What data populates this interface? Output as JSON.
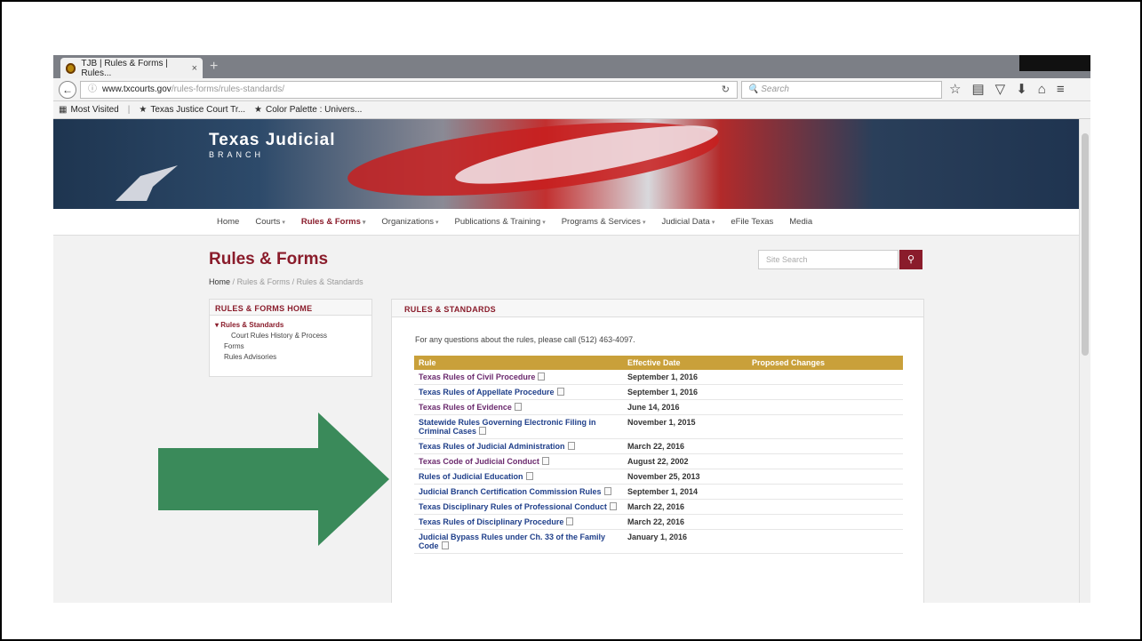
{
  "browser": {
    "tab_title": "TJB | Rules & Forms | Rules...",
    "tab_close": "×",
    "new_tab": "+",
    "url_host": "www.txcourts.gov",
    "url_path": "/rules-forms/rules-standards/",
    "search_placeholder": "Search",
    "bookmarks": [
      "Most Visited",
      "Texas Justice Court Tr...",
      "Color Palette : Univers..."
    ]
  },
  "site": {
    "brand_title": "Texas Judicial",
    "brand_sub": "BRANCH",
    "nav": [
      {
        "label": "Home",
        "caret": ""
      },
      {
        "label": "Courts",
        "caret": "▾"
      },
      {
        "label": "Rules & Forms",
        "caret": "▾"
      },
      {
        "label": "Organizations",
        "caret": "▾"
      },
      {
        "label": "Publications & Training",
        "caret": "▾"
      },
      {
        "label": "Programs & Services",
        "caret": "▾"
      },
      {
        "label": "Judicial Data",
        "caret": "▾"
      },
      {
        "label": "eFile Texas",
        "caret": ""
      },
      {
        "label": "Media",
        "caret": ""
      }
    ],
    "page_title": "Rules & Forms",
    "breadcrumb": {
      "home": "Home",
      "sep": "/",
      "level1": "Rules & Forms",
      "level2": "Rules & Standards"
    },
    "site_search_placeholder": "Site Search"
  },
  "sidebar": {
    "heading": "RULES & FORMS HOME",
    "items": [
      {
        "label": "Rules & Standards",
        "selected": true
      },
      {
        "label": "Court Rules History & Process"
      },
      {
        "label": "Forms"
      },
      {
        "label": "Rules Advisories"
      }
    ]
  },
  "main": {
    "heading": "RULES & STANDARDS",
    "intro": "For any questions about the rules, please call (512) 463-4097.",
    "columns": [
      "Rule",
      "Effective Date",
      "Proposed Changes"
    ],
    "rows": [
      {
        "rule": "Texas Rules of Civil Procedure",
        "date": "September 1, 2016",
        "visited": true
      },
      {
        "rule": "Texas Rules of Appellate Procedure",
        "date": "September 1, 2016",
        "visited": false
      },
      {
        "rule": "Texas Rules of Evidence",
        "date": "June 14, 2016",
        "visited": true
      },
      {
        "rule": "Statewide Rules Governing Electronic Filing in Criminal Cases",
        "date": "November 1, 2015",
        "visited": false
      },
      {
        "rule": "Texas Rules of Judicial Administration",
        "date": "March 22, 2016",
        "visited": false
      },
      {
        "rule": "Texas Code of Judicial Conduct",
        "date": "August 22, 2002",
        "visited": true
      },
      {
        "rule": "Rules of Judicial Education",
        "date": "November 25, 2013",
        "visited": false
      },
      {
        "rule": "Judicial Branch Certification Commission Rules",
        "date": "September 1, 2014",
        "visited": false
      },
      {
        "rule": "Texas Disciplinary Rules of Professional Conduct",
        "date": "March 22, 2016",
        "visited": false
      },
      {
        "rule": "Texas Rules of Disciplinary Procedure",
        "date": "March 22, 2016",
        "visited": false
      },
      {
        "rule": "Judicial Bypass Rules under Ch. 33 of the Family Code",
        "date": "January 1, 2016",
        "visited": false
      }
    ]
  },
  "colors": {
    "brand": "#8a1c2b",
    "table_header": "#c9a03a",
    "arrow": "#3a8a5a",
    "link": "#1f3f8a"
  }
}
